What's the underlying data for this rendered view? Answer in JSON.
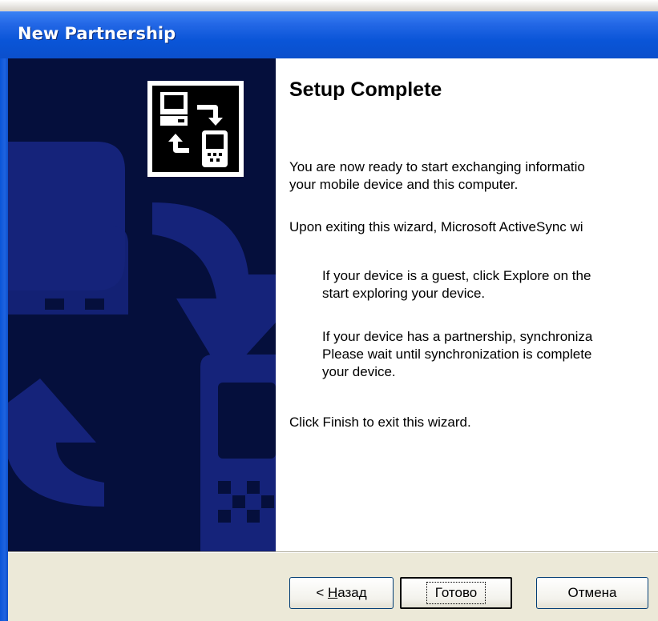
{
  "window": {
    "title": "New Partnership"
  },
  "main": {
    "heading": "Setup Complete",
    "para1_line1": "You are now ready to start exchanging informatio",
    "para1_line2": "your mobile device and this computer.",
    "para2": "Upon exiting this wizard, Microsoft ActiveSync wi",
    "para3_line1": "If your device is a guest, click Explore on the",
    "para3_line2": "start exploring your device.",
    "para4_line1": "If your device has a partnership, synchroniza",
    "para4_line2": "Please wait until synchronization is complete",
    "para4_line3": "your device.",
    "para5": "Click Finish to exit this wizard."
  },
  "buttons": {
    "back_prefix": "< ",
    "back_hotkey": "Н",
    "back_rest": "азад",
    "finish_label": "Готово",
    "cancel_label": "Отмена"
  },
  "colors": {
    "banner_bg": "#050f3c",
    "banner_shapes": "#15237a",
    "titlebar": "#0a55d8"
  },
  "icons": {
    "wizard_icon": "computer-and-device-sync-icon"
  }
}
